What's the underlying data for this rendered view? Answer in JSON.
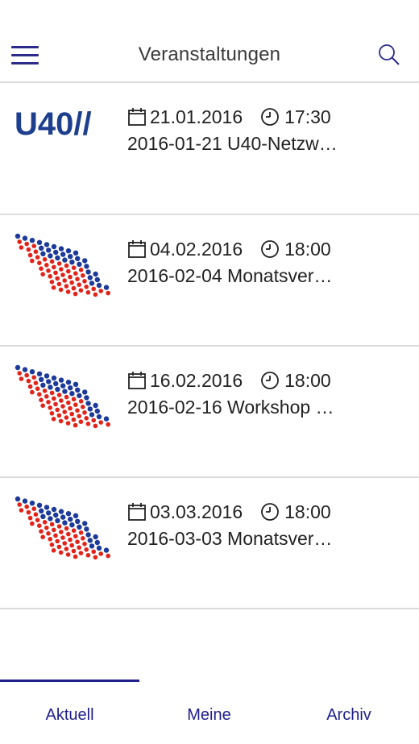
{
  "appbar": {
    "title": "Veranstaltungen",
    "menu_icon": "hamburger-menu-icon",
    "search_icon": "search-icon"
  },
  "colors": {
    "accent": "#1f1f8a",
    "logo_blue": "#1e3f8e",
    "dot_red": "#e2231a",
    "dot_blue": "#1c3a9a",
    "divider": "#dcdcdc"
  },
  "events": [
    {
      "logo": "u40-logo",
      "logo_text": "U40//",
      "date": "21.01.2016",
      "time": "17:30",
      "title": "2016-01-21 U40-Netzw…"
    },
    {
      "logo": "dot-pattern-logo",
      "date": "04.02.2016",
      "time": "18:00",
      "title": "2016-02-04 Monatsver…"
    },
    {
      "logo": "dot-pattern-logo",
      "date": "16.02.2016",
      "time": "18:00",
      "title": "2016-02-16 Workshop …"
    },
    {
      "logo": "dot-pattern-logo",
      "date": "03.03.2016",
      "time": "18:00",
      "title": "2016-03-03 Monatsver…"
    }
  ],
  "tabs": [
    {
      "label": "Aktuell",
      "active": true
    },
    {
      "label": "Meine",
      "active": false
    },
    {
      "label": "Archiv",
      "active": false
    }
  ]
}
